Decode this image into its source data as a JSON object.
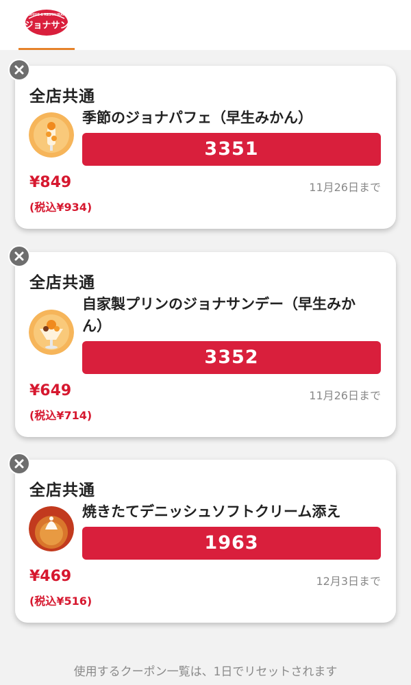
{
  "header": {
    "logo_text": "COFFEE & RESTAURANT ジョナサン"
  },
  "coupons": [
    {
      "scope": "全店共通",
      "name": "季節のジョナパフェ（早生みかん）",
      "code": "3351",
      "price": "¥849",
      "taxed_price": "(税込¥934)",
      "expires": "11月26日まで"
    },
    {
      "scope": "全店共通",
      "name": "自家製プリンのジョナサンデー（早生みかん）",
      "code": "3352",
      "price": "¥649",
      "taxed_price": "(税込¥714)",
      "expires": "11月26日まで"
    },
    {
      "scope": "全店共通",
      "name": "焼きたてデニッシュソフトクリーム添え",
      "code": "1963",
      "price": "¥469",
      "taxed_price": "(税込¥516)",
      "expires": "12月3日まで"
    }
  ],
  "footer": {
    "note": "使用するクーポン一覧は、1日でリセットされます"
  },
  "colors": {
    "accent_red": "#d91f3c",
    "tab_orange": "#e6822a",
    "close_grey": "#6e6e6e"
  },
  "icons": {
    "close": "close-icon",
    "logo": "jonathan-logo-icon"
  }
}
